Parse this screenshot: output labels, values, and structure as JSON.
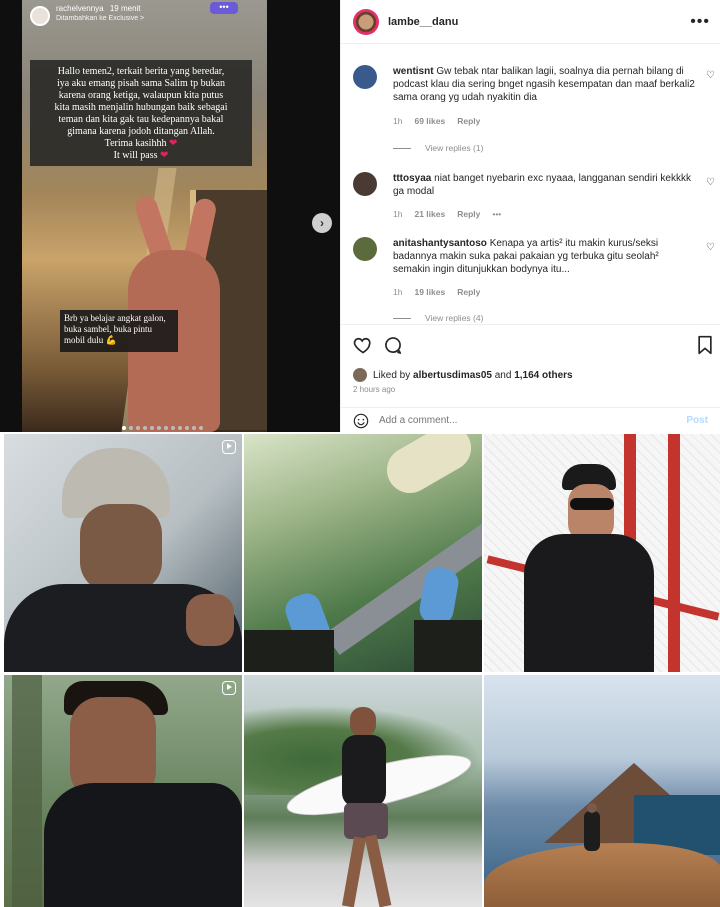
{
  "story": {
    "username": "rachelvennya",
    "time": "19 menit",
    "subline": "Ditambahkan ke Exclusive >",
    "more_label": "•••",
    "caption_lines": [
      "Hallo temen2, terkait berita yang beredar,",
      "iya aku emang pisah sama Salim tp bukan",
      "karena orang ketiga, walaupun kita putus",
      "kita masih menjalin hubungan baik sebagai",
      "teman dan kita gak tau kedepannya bakal",
      "gimana karena jodoh ditangan Allah.",
      "Terima kasihhh",
      "It will pass"
    ],
    "caption2": "Brb ya belajar angkat galon, buka sambel, buka pintu mobil dulu 💪",
    "next_icon": "›"
  },
  "post": {
    "username": "lambe__danu",
    "more_icon": "•••",
    "comments": [
      {
        "user": "wentisnt",
        "text": "Gw tebak ntar balikan lagii, soalnya dia pernah bilang di podcast klau dia sering bnget ngasih kesempatan dan maaf berkali2 sama orang yg udah nyakitin dia",
        "time": "1h",
        "likes": "69 likes",
        "reply": "Reply",
        "view_replies": "View replies (1)",
        "avatar_color": "#3a5a8c"
      },
      {
        "user": "tttosyaa",
        "text": "niat banget nyebarin exc nyaaa, langganan sendiri kekkkk ga modal",
        "time": "1h",
        "likes": "21 likes",
        "reply": "Reply",
        "extra": "•••",
        "avatar_color": "#4a3a34"
      },
      {
        "user": "anitashantysantoso",
        "text": "Kenapa ya artis² itu makin kurus/seksi badannya makin suka pakai pakaian yg terbuka gitu seolah² semakin ingin ditunjukkan bodynya itu...",
        "time": "1h",
        "likes": "19 likes",
        "reply": "Reply",
        "view_replies": "View replies (4)",
        "avatar_color": "#5c6b3c"
      }
    ],
    "liked_by_prefix": "Liked by",
    "liked_by_user": "albertusdimas05",
    "liked_by_and": "and",
    "liked_by_count": "1,164 others",
    "time_ago": "2 hours ago",
    "comment_placeholder": "Add a comment...",
    "post_button": "Post"
  },
  "grid": {
    "tiles": [
      {
        "name": "tile-beanie-man",
        "reel": true
      },
      {
        "name": "tile-legs-over-sea",
        "reel": false
      },
      {
        "name": "tile-sunglasses-man",
        "reel": false
      },
      {
        "name": "tile-wetsuit-man",
        "reel": true
      },
      {
        "name": "tile-surfboard-man",
        "reel": false
      },
      {
        "name": "tile-mountain-hiker",
        "reel": false
      }
    ]
  },
  "colors": {
    "accent_pink": "#e1306c",
    "post_button": "#b3dbff",
    "muted_text": "#8e8e8e",
    "story_label": "#6b5bd6"
  }
}
